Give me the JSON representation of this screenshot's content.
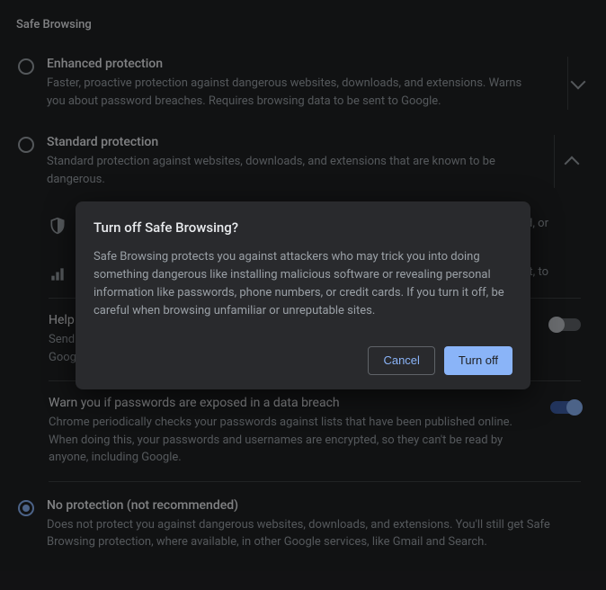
{
  "section_title": "Safe Browsing",
  "options": {
    "enhanced": {
      "title": "Enhanced protection",
      "desc": "Faster, proactive protection against dangerous websites, downloads, and extensions. Warns you about password breaches. Requires browsing data to be sent to Google."
    },
    "standard": {
      "title": "Standard protection",
      "desc": "Standard protection against websites, downloads, and extensions that are known to be dangerous.",
      "sub1": "sword, or",
      "sub2": "ontent, to"
    },
    "none": {
      "title": "No protection (not recommended)",
      "desc": "Does not protect you against dangerous websites, downloads, and extensions. You'll still get Safe Browsing protection, where available, in other Google services, like Gmail and Search."
    }
  },
  "toggles": {
    "help_improve": {
      "title": "Help",
      "desc_line1": "Send",
      "desc_line2": "Goog",
      "on": false
    },
    "warn_passwords": {
      "title": "Warn you if passwords are exposed in a data breach",
      "desc": "Chrome periodically checks your passwords against lists that have been published online. When doing this, your passwords and usernames are encrypted, so they can't be read by anyone, including Google.",
      "on": true
    }
  },
  "dialog": {
    "title": "Turn off Safe Browsing?",
    "body": "Safe Browsing protects you against attackers who may trick you into doing something dangerous like installing malicious software or revealing personal information like passwords, phone numbers, or credit cards. If you turn it off, be careful when browsing unfamiliar or unreputable sites.",
    "cancel": "Cancel",
    "confirm": "Turn off"
  }
}
